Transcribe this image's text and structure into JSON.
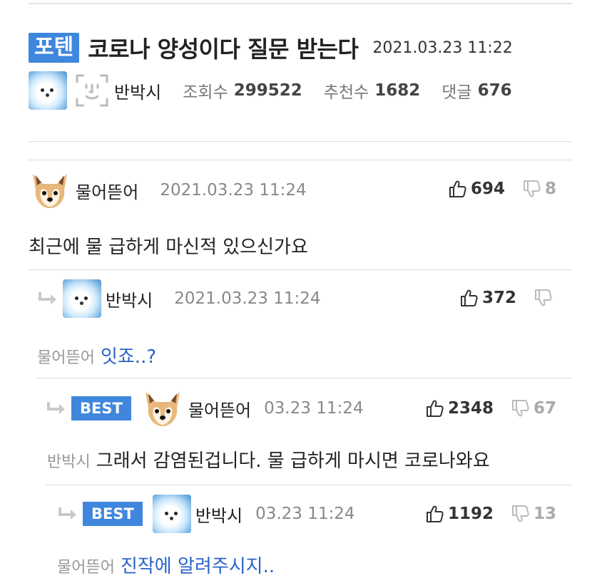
{
  "post": {
    "category": "포텐",
    "title": "코로나 양성이다 질문 받는다",
    "date": "2021.03.23 11:22",
    "author": "반박시",
    "views_label": "조회수",
    "views": "299522",
    "recommend_label": "추천수",
    "recommend": "1682",
    "comments_label": "댓글",
    "comments": "676"
  },
  "comments": [
    {
      "author": "물어뜯어",
      "date": "2021.03.23 11:24",
      "up": "694",
      "down": "8",
      "text": "최근에 물 급하게 마신적 있으신가요"
    },
    {
      "author": "반박시",
      "date": "2021.03.23 11:24",
      "up": "372",
      "mention": "물어뜯어",
      "text": "잇죠..?"
    },
    {
      "best": "BEST",
      "author": "물어뜯어",
      "date": "03.23 11:24",
      "up": "2348",
      "down": "67",
      "mention": "반박시",
      "text": "그래서 감염된겁니다. 물 급하게 마시면 코로나와요"
    },
    {
      "best": "BEST",
      "author": "반박시",
      "date": "03.23 11:24",
      "up": "1192",
      "down": "13",
      "mention": "물어뜯어",
      "text": "진작에 알려주시지.."
    }
  ]
}
